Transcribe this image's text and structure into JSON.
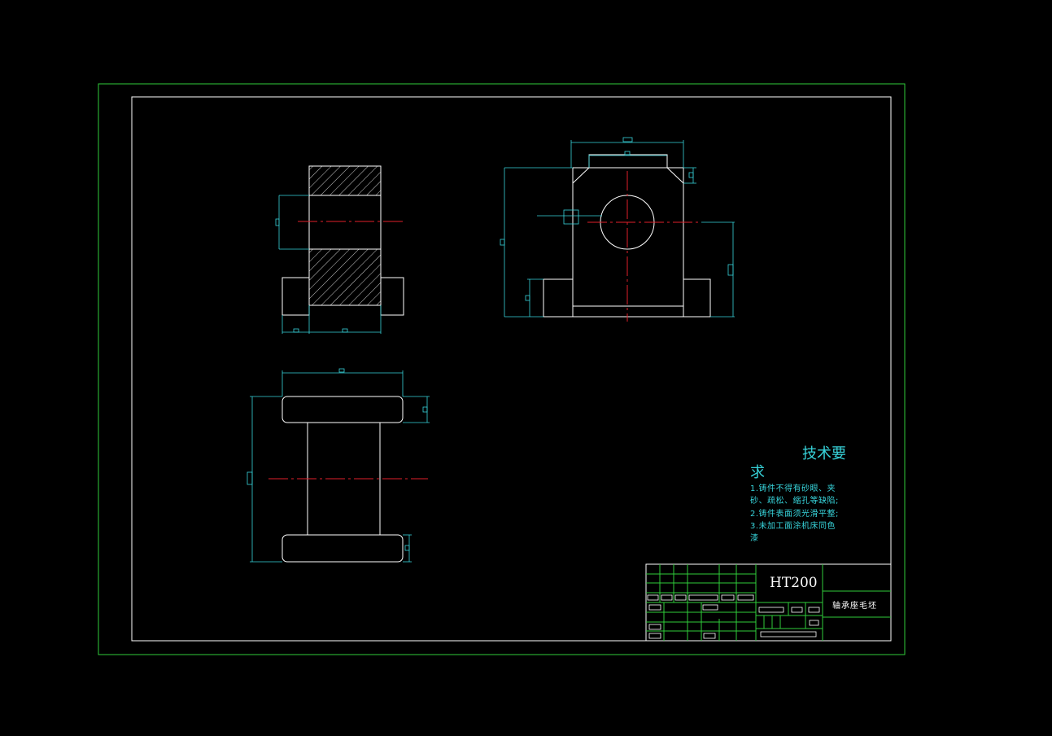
{
  "technical_requirements": {
    "title_part1": "技术要",
    "title_part2": "求",
    "lines": [
      "1.铸件不得有砂眼、夹",
      "砂、疏松、缩孔等缺陷;",
      "2.铸件表面须光滑平整;",
      "3.未加工面涂机床同色",
      "漆"
    ]
  },
  "title_block": {
    "material": "HT200",
    "part_name": "轴承座毛坯"
  },
  "colors": {
    "background": "#000000",
    "outer_frame": "#2fcc3a",
    "object_lines": "#ffffff",
    "dimensions": "#37d3da",
    "centerlines": "#e0202a",
    "title_block_grid": "#2fcc3a"
  }
}
